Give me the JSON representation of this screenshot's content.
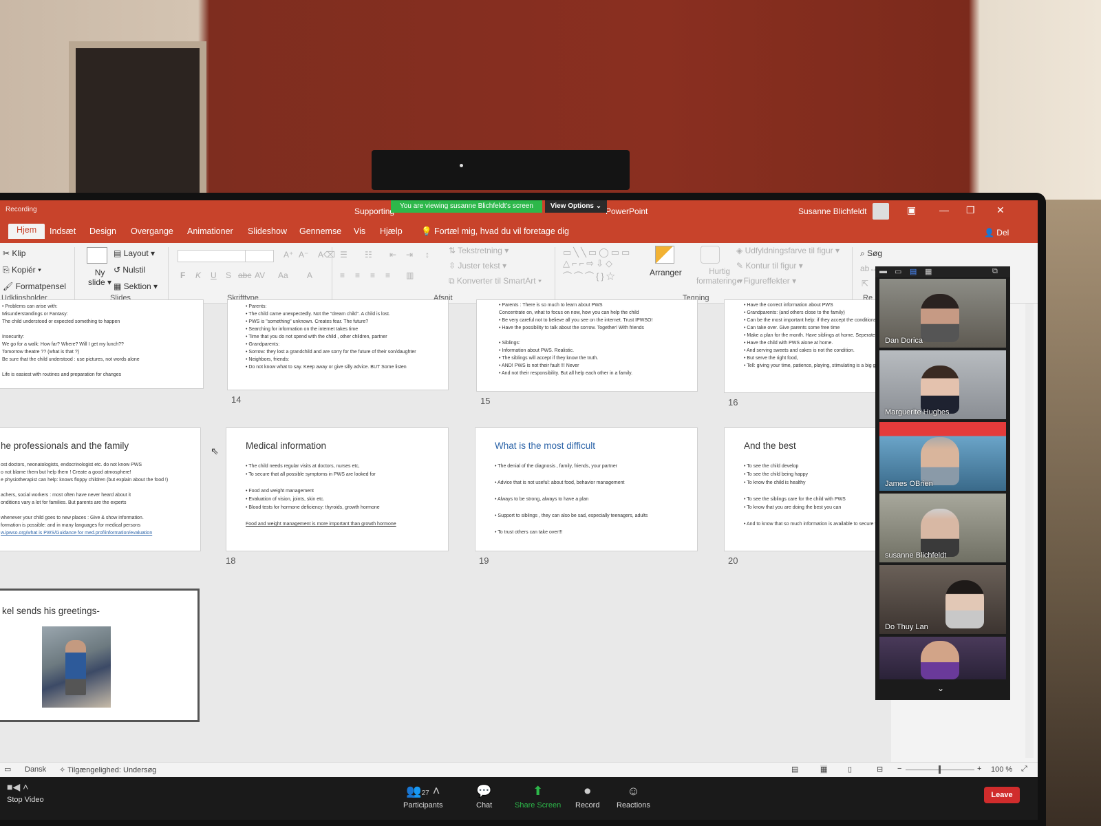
{
  "titlebar": {
    "recording": "Recording",
    "doc_title": "Supporting",
    "doc_suffix": "PowerPoint",
    "share_banner": "You are viewing susanne Blichfeldt's screen",
    "view_options": "View Options ⌄",
    "user": "Susanne Blichfeldt"
  },
  "tabs": [
    "Hjem",
    "Indsæt",
    "Design",
    "Overgange",
    "Animationer",
    "Slideshow",
    "Gennemse",
    "Vis",
    "Hjælp"
  ],
  "tell_me": "Fortæl mig, hvad du vil foretage dig",
  "share_label": "Del",
  "ribbon": {
    "clipboard": {
      "cut": "Klip",
      "copy": "Kopiér",
      "painter": "Formatpensel",
      "label": "Udklipsholder"
    },
    "slides": {
      "new_slide_1": "Ny",
      "new_slide_2": "slide",
      "layout": "Layout",
      "reset": "Nulstil",
      "section": "Sektion",
      "label": "Slides"
    },
    "font": {
      "bold": "F",
      "italic": "K",
      "underline": "U",
      "shadow": "S",
      "strike": "abc",
      "spacing": "AV",
      "case": "Aa",
      "color": "A",
      "label": "Skrifttype"
    },
    "paragraph": {
      "direction": "Tekstretning",
      "align": "Juster tekst",
      "smartart": "Konverter til SmartArt",
      "label": "Afsnit"
    },
    "drawing": {
      "arrange": "Arranger",
      "quick_1": "Hurtig",
      "quick_2": "formatering",
      "fill": "Udfyldningsfarve til figur",
      "outline": "Kontur til figur",
      "effects": "Figureffekter",
      "label": "Tegning"
    },
    "editing": {
      "search": "Søg",
      "label": "Re"
    }
  },
  "slides": {
    "s13": {
      "lines": [
        "• Problems can arise with:",
        "Misunderstandings or Fantasy:",
        "The child understood or expected something to happen",
        "",
        "Insecurity:",
        "We go for a walk: How far? Where? Will I get my lunch??",
        "Tomorrow theatre ?? (what is that ?)",
        "Be sure that the child understood : use pictures, not words alone",
        "",
        "Life is easiest with routines and preparation for changes"
      ]
    },
    "s14": {
      "num": "14",
      "lines": [
        "• Parents:",
        "• The child came unexpectedly. Not the \"dream child\". A child is lost.",
        "• PWS is \"something\" unknown. Creates fear. The future?",
        "• Searching for information on the internet takes time",
        "• Time that you do not spend with the child , other children, partner",
        "• Grandparents:",
        "• Sorrow: they lost a grandchild and are sorry for the future of their son/daughter",
        "• Neighbors, friends:",
        "• Do not know what to say. Keep away or give silly advice. BUT Some listen"
      ]
    },
    "s15": {
      "num": "15",
      "lines": [
        "• Parents : There is so much to learn about PWS",
        "  Concentrate on, what to focus on now, how you can help the child",
        "• Be very careful not to believe all you see on the internet. Trust IPWSO!",
        "• Have the possibility to talk about the sorrow. Together! With friends",
        "",
        "• Siblings:",
        "• Information about PWS. Realistic.",
        "• The siblings will accept if they know the truth.",
        "• AND! PWS is not their fault !!! Never",
        "• And not their responsibility. But all help each other in a family."
      ]
    },
    "s16": {
      "num": "16",
      "lines": [
        "• Have the correct information about PWS",
        "• Grandparents: (and others close to the family)",
        "• Can be the most important help: if they accept the conditions",
        "• Can take over. Give parents some free time",
        "• Make a plan for the month. Have siblings at home. Seperately",
        "• Have the child with PWS alone at home.",
        "• And serving sweets and cakes is not the condition.",
        "• But serve the right food,",
        "• Tell: giving your time, patience, playing, stimulating is a big gift"
      ]
    },
    "s17": {
      "title": "he professionals and the family",
      "lines": [
        "ost doctors, neonatologists, endocrinologist etc. do not know PWS",
        "o not blame them but help them ! Create a good atmosphere!",
        "e physiotherapist can help: knows floppy children (but explain about the food !)",
        "",
        "achers, social workers : most often have never heard about it",
        "onditions vary a lot for families. But parents are the experts",
        "",
        "whenever your child goes to new places : Give & show information.",
        "formation is possible: and in many languages for medical persons",
        "w.ipwso.org/what is PWS/Guidance for med.prof/information/evaluation"
      ]
    },
    "s18": {
      "num": "18",
      "title": "Medical information",
      "lines": [
        "• The child needs regular visits at doctors, nurses etc,",
        "• To secure that all possible symptoms in PWS are looked for",
        "",
        "• Food and weight management",
        "• Evaluation of vision, joints, skin etc.",
        "• Blood tests for hormone deficiency: thyroids, growth hormone",
        "",
        "Food and weight management is more important than growth hormone"
      ]
    },
    "s19": {
      "num": "19",
      "title": "What is the most difficult",
      "lines": [
        "• The denial of the diagnosis , family, friends, your partner",
        "",
        "• Advice that is not useful: about food, behavior management",
        "",
        "• Always to be strong, always to have a plan",
        "",
        "• Support to siblings , they can also be sad, especially teenagers, adults",
        "",
        "• To trust others can take over!!!"
      ]
    },
    "s20": {
      "num": "20",
      "title": "And the best",
      "lines": [
        "• To see the child develop",
        "• To see the child being happy",
        "• To know the child is healthy",
        "",
        "• To see the siblings care for the child with PWS",
        "• To know that you are doing the best you can",
        "",
        "• And to know that so much information is available to secure the child"
      ]
    },
    "s21": {
      "title": "kel sends his greetings-"
    }
  },
  "participants": [
    {
      "name": "Dan Dorica"
    },
    {
      "name": "Marguerite Hughes"
    },
    {
      "name": "James OBrien"
    },
    {
      "name": "susanne Blichfeldt"
    },
    {
      "name": "Do Thuy Lan"
    },
    {
      "name": ""
    }
  ],
  "statusbar": {
    "language": "Dansk",
    "accessibility": "Tilgængelighed: Undersøg",
    "zoom": "100 %"
  },
  "zoom_toolbar": {
    "stop_video": "Stop Video",
    "participants_count": "27",
    "participants": "Participants",
    "chat": "Chat",
    "share_screen": "Share Screen",
    "record": "Record",
    "reactions": "Reactions",
    "leave": "Leave"
  },
  "colors": {
    "ppt_accent": "#c8432b",
    "zoom_green": "#2db84a",
    "leave_red": "#d02c2c",
    "slide_title_blue": "#2c64a8"
  }
}
